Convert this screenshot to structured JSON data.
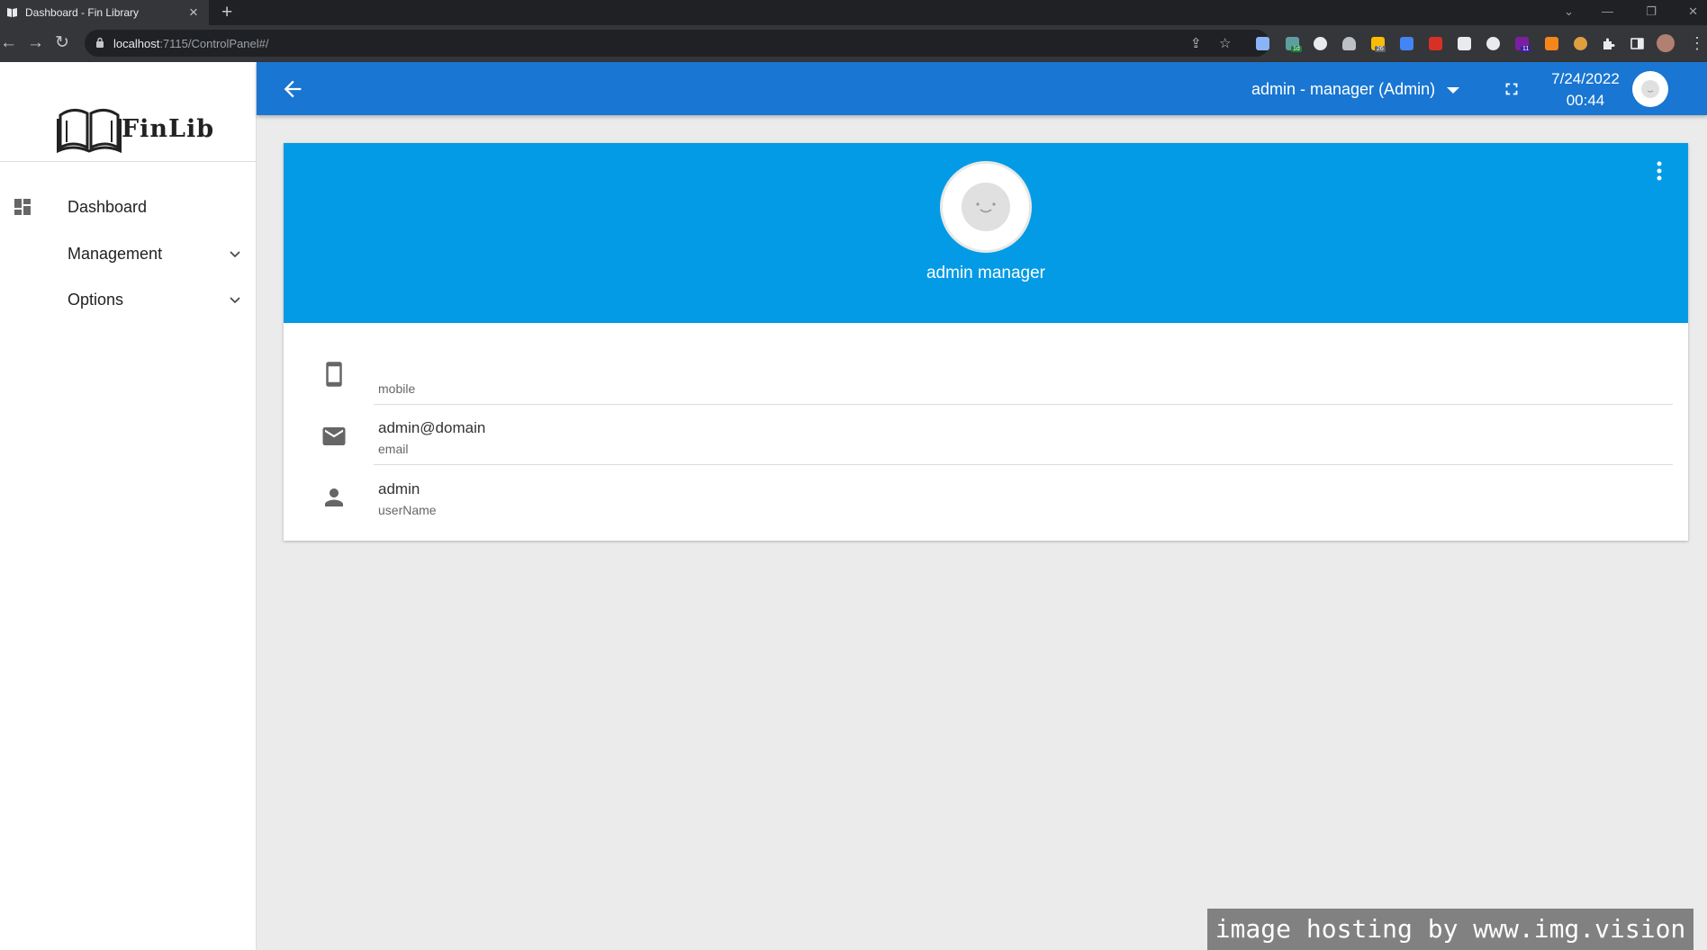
{
  "browser": {
    "tab_title": "Dashboard - Fin Library",
    "tab_close": "×",
    "new_tab": "+",
    "url_host": "localhost",
    "url_rest": ":7115/ControlPanel#/",
    "window_minimize": "—",
    "window_restore": "❐",
    "window_close": "✕",
    "window_tabsearch": "⌄",
    "nav_back": "←",
    "nav_forward": "→",
    "nav_reload": "↻",
    "share_glyph": "⇪",
    "star_glyph": "☆",
    "menu_glyph": "⋮",
    "ext_badges": [
      "1d",
      "26",
      "11"
    ]
  },
  "sidebar": {
    "logo_text": "FinLib",
    "items": [
      {
        "label": "Dashboard",
        "icon": "dashboard-icon",
        "expandable": false
      },
      {
        "label": "Management",
        "icon": "",
        "expandable": true
      },
      {
        "label": "Options",
        "icon": "",
        "expandable": true
      }
    ]
  },
  "appbar": {
    "user_label": "admin - manager (Admin)",
    "date": "7/24/2022",
    "time": "00:44"
  },
  "profile": {
    "full_name": "admin manager",
    "fields": [
      {
        "value": "",
        "label": "mobile",
        "icon": "phone-icon"
      },
      {
        "value": "admin@domain",
        "label": "email",
        "icon": "email-icon"
      },
      {
        "value": "admin",
        "label": "userName",
        "icon": "person-icon"
      }
    ]
  },
  "colors": {
    "appbar": "#1976d2",
    "profile_header": "#039be5",
    "background": "#ebebeb"
  },
  "watermark": "image hosting by www.img.vision"
}
